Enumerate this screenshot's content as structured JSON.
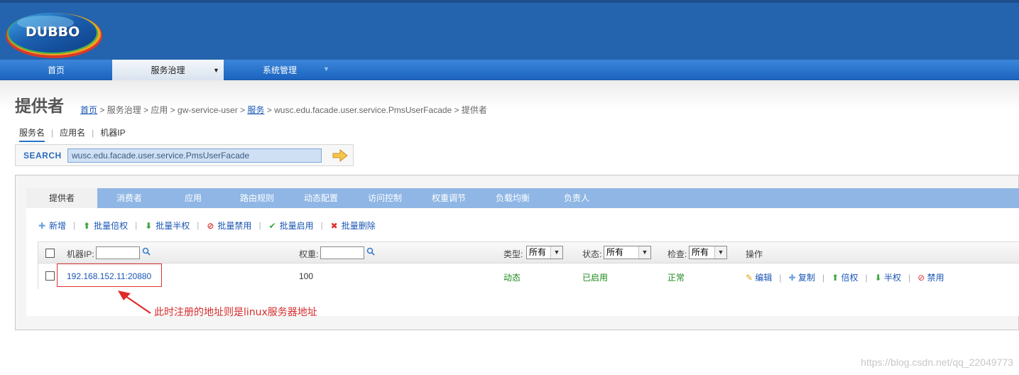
{
  "logo": {
    "text": "DUBBO"
  },
  "nav": {
    "items": [
      {
        "label": "首页"
      },
      {
        "label": "服务治理",
        "arrow": "▼"
      },
      {
        "label": "系统管理",
        "arrow": "▼"
      }
    ]
  },
  "page": {
    "title": "提供者",
    "breadcrumb": {
      "home": "首页",
      "part1": " > 服务治理 > 应用 > gw-service-user > ",
      "service": "服务",
      "part2": " > wusc.edu.facade.user.service.PmsUserFacade > 提供者"
    }
  },
  "subtabs": [
    "服务名",
    "应用名",
    "机器IP"
  ],
  "search": {
    "label": "SEARCH",
    "value": "wusc.edu.facade.user.service.PmsUserFacade"
  },
  "tabs": [
    "提供者",
    "消费者",
    "应用",
    "路由规则",
    "动态配置",
    "访问控制",
    "权重调节",
    "负载均衡",
    "负责人"
  ],
  "toolbar": {
    "add": "新增",
    "batch_double": "批量倍权",
    "batch_half": "批量半权",
    "batch_disable": "批量禁用",
    "batch_enable": "批量启用",
    "batch_delete": "批量删除"
  },
  "table": {
    "headers": {
      "ip": "机器IP:",
      "weight": "权重:",
      "type": "类型:",
      "status": "状态:",
      "check": "检查:",
      "ops": "操作"
    },
    "filters": {
      "type": "所有",
      "status": "所有",
      "check": "所有"
    },
    "rows": [
      {
        "ip": "192.168.152.11:20880",
        "weight": "100",
        "type": "动态",
        "status": "已启用",
        "check": "正常"
      }
    ],
    "row_ops": {
      "edit": "编辑",
      "copy": "复制",
      "double": "倍权",
      "half": "半权",
      "disable": "禁用"
    }
  },
  "annotation": "此时注册的地址则是linux服务器地址",
  "watermark": "https://blog.csdn.net/qq_22049773",
  "colors": {
    "header": "#2463ad",
    "tab_strip": "#8fb6e4",
    "link": "#1a56b5",
    "status_green": "#1d8a1d",
    "annotation_red": "#d42a2a"
  }
}
